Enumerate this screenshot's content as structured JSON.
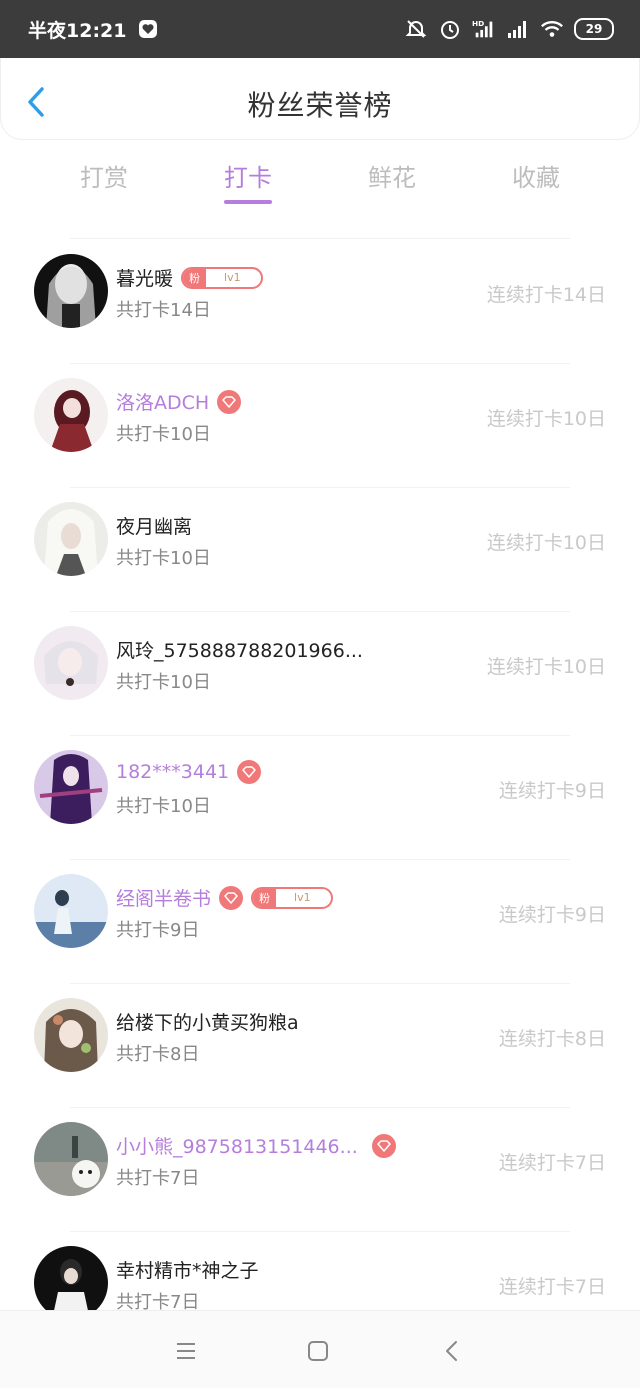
{
  "status": {
    "time": "半夜12:21",
    "battery": "29",
    "icons": [
      "heart-app-icon",
      "mute-icon",
      "alarm-icon",
      "signal-hd-icon",
      "signal-icon",
      "wifi-icon",
      "battery-icon"
    ]
  },
  "header": {
    "title": "粉丝荣誉榜",
    "back_icon": "chevron-left-icon"
  },
  "tabs": [
    {
      "label": "打赏",
      "active": false
    },
    {
      "label": "打卡",
      "active": true
    },
    {
      "label": "鲜花",
      "active": false
    },
    {
      "label": "收藏",
      "active": false
    }
  ],
  "colors": {
    "accent": "#b57edc",
    "badge": "#f07878",
    "muted": "#c9c9c9"
  },
  "rows": [
    {
      "name": "暮光暖",
      "vip": false,
      "fan_badge": true,
      "fan_label": "粉",
      "fan_level": "lv1",
      "total": "共打卡14日",
      "streak": "连续打卡14日"
    },
    {
      "name": "洛洛ADCH",
      "vip": true,
      "fan_badge": false,
      "total": "共打卡10日",
      "streak": "连续打卡10日"
    },
    {
      "name": "夜月幽离",
      "vip": false,
      "fan_badge": false,
      "total": "共打卡10日",
      "streak": "连续打卡10日"
    },
    {
      "name": "风玲_575888788201966...",
      "vip": false,
      "fan_badge": false,
      "total": "共打卡10日",
      "streak": "连续打卡10日"
    },
    {
      "name": "182***3441",
      "vip": true,
      "fan_badge": false,
      "total": "共打卡10日",
      "streak": "连续打卡9日"
    },
    {
      "name": "经阁半卷书",
      "vip": true,
      "fan_badge": true,
      "fan_label": "粉",
      "fan_level": "lv1",
      "total": "共打卡9日",
      "streak": "连续打卡9日"
    },
    {
      "name": "给楼下的小黄买狗粮a",
      "vip": false,
      "fan_badge": false,
      "total": "共打卡8日",
      "streak": "连续打卡8日"
    },
    {
      "name": "小小熊_9875813151446...",
      "vip": true,
      "fan_badge": false,
      "total": "共打卡7日",
      "streak": "连续打卡7日"
    },
    {
      "name": "幸村精市*神之子",
      "vip": false,
      "fan_badge": false,
      "total": "共打卡7日",
      "streak": "连续打卡7日"
    }
  ],
  "navbar": {
    "icons": [
      "menu-icon",
      "home-square-icon",
      "back-triangle-icon"
    ]
  }
}
